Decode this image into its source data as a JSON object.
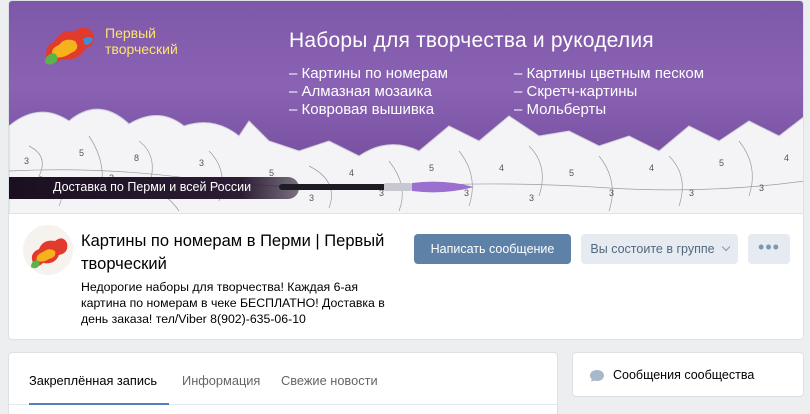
{
  "cover": {
    "logo_text_line1": "Первый",
    "logo_text_line2": "творческий",
    "title": "Наборы для творчества и рукоделия",
    "list_left": [
      "– Картины по номерам",
      "– Алмазная мозаика",
      "– Ковровая вышивка"
    ],
    "list_right": [
      "– Картины цветным песком",
      "– Скретч-картины",
      "– Мольберты"
    ],
    "delivery": "Доставка по Перми и всей России"
  },
  "group": {
    "title": "Картины по номерам в Перми | Первый творческий",
    "status": "Недорогие наборы для творчества! Каждая 6-ая картина по номерам в чеке БЕСПЛАТНО! Доставка в день заказа! тел/Viber 8(902)-635-06-10"
  },
  "actions": {
    "write_message": "Написать сообщение",
    "member_status": "Вы состоите в группе",
    "more": "•••"
  },
  "tabs": [
    {
      "label": "Закреплённая запись",
      "active": true
    },
    {
      "label": "Информация",
      "active": false
    },
    {
      "label": "Свежие новости",
      "active": false
    }
  ],
  "sidebar": {
    "community_messages": "Сообщения сообщества"
  },
  "colors": {
    "accent": "#5181b8",
    "button_primary": "#5e81a8",
    "button_secondary": "#e5ebf1",
    "cover_purple": "#7e58a8",
    "logo_text": "#ffe46a"
  }
}
